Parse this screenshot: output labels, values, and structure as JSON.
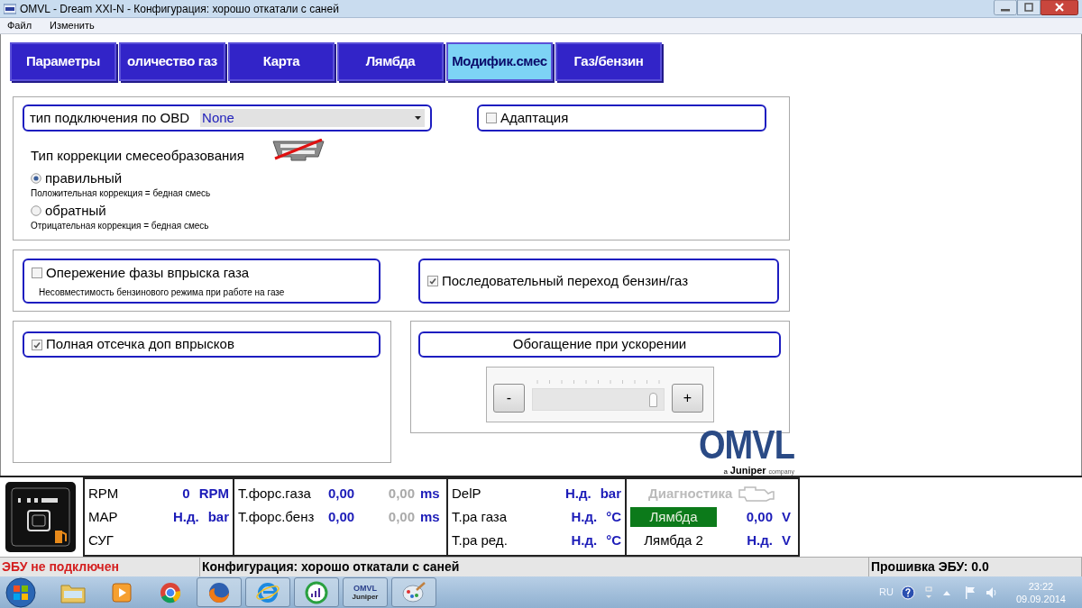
{
  "window": {
    "title": "OMVL - Dream XXI-N - Конфигурация: хорошо откатали с саней"
  },
  "menu": [
    "Файл",
    "Изменить"
  ],
  "tabs": [
    {
      "label": "Параметры",
      "selected": false
    },
    {
      "label": "оличество газ",
      "selected": false
    },
    {
      "label": "Карта",
      "selected": false
    },
    {
      "label": "Лямбда",
      "selected": false
    },
    {
      "label": "Модифик.смес",
      "selected": true
    },
    {
      "label": "Газ/бензин",
      "selected": false
    }
  ],
  "obd": {
    "label": "тип подключения по OBD",
    "value": "None"
  },
  "adaptation": {
    "label": "Адаптация",
    "checked": false
  },
  "correction": {
    "title": "Тип коррекции смесеобразования",
    "options": [
      {
        "label": "правильный",
        "note": "Положительная коррекция = бедная смесь",
        "selected": true
      },
      {
        "label": "обратный",
        "note": "Отрицательная коррекция = бедная смесь",
        "selected": false
      }
    ]
  },
  "injection_advance": {
    "label": "Опережение фазы впрыска газа",
    "note": "Несовместимость бензинового режима при работе на газе",
    "checked": false
  },
  "sequential": {
    "label": "Последовательный переход бензин/газ",
    "checked": true
  },
  "full_cutoff": {
    "label": "Полная отсечка доп впрысков",
    "checked": true
  },
  "enrichment": {
    "title": "Обогащение при ускорении",
    "minus": "-",
    "plus": "+",
    "level": 0.95
  },
  "logo": {
    "name": "OMVL",
    "tagline_prefix": "a",
    "tagline_brand": "Juniper",
    "tagline_suffix": "company"
  },
  "gauges": {
    "column_1": [
      {
        "label": "RPM",
        "value": "0",
        "unit": "RPM"
      },
      {
        "label": "MAP",
        "value": "Н.д.",
        "unit": "bar"
      },
      {
        "label": "СУГ"
      }
    ],
    "column_2": [
      {
        "label": "Т.форс.газа",
        "value": "0,00",
        "value_2": "0,00",
        "unit": "ms"
      },
      {
        "label": "Т.форс.бенз",
        "value": "0,00",
        "value_2": "0,00",
        "unit": "ms"
      }
    ],
    "column_3": [
      {
        "label": "DelP",
        "value": "Н.д.",
        "unit": "bar"
      },
      {
        "label": "Т.ра газа",
        "value": "Н.д.",
        "unit": "°C"
      },
      {
        "label": "Т.ра ред.",
        "value": "Н.д.",
        "unit": "°C"
      }
    ],
    "diagnostics": {
      "label": "Диагностика",
      "active": false
    },
    "lambdas": [
      {
        "label": "Лямбда",
        "value": "0,00",
        "unit": "V",
        "active": true
      },
      {
        "label": "Лямбда 2",
        "value": "Н.д.",
        "unit": "V",
        "active": false
      }
    ]
  },
  "status_bar": [
    {
      "text": "ЭБУ не подключен",
      "kind": "error"
    },
    {
      "text": "Конфигурация: хорошо откатали с саней",
      "kind": "info"
    },
    {
      "text": "Прошивка ЭБУ: 0.0",
      "kind": "info"
    }
  ],
  "taskbar": {
    "apps": [
      {
        "kind": "folder",
        "running": false
      },
      {
        "kind": "player",
        "running": false
      },
      {
        "kind": "chrome",
        "running": false
      },
      {
        "kind": "firefox",
        "running": true
      },
      {
        "kind": "ie",
        "running": true
      },
      {
        "kind": "meter",
        "running": true
      },
      {
        "kind": "omvl",
        "running": true,
        "line_1": "OMVL",
        "line_2": "Juniper"
      },
      {
        "kind": "paint",
        "running": true
      }
    ],
    "language": "RU",
    "time": "23:22",
    "date": "09.09.2014"
  }
}
